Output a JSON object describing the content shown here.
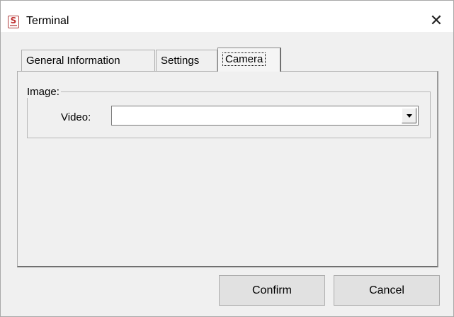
{
  "window": {
    "title": "Terminal",
    "app_icon_glyph": "S",
    "close_glyph": "✕"
  },
  "tabs": [
    {
      "label": "General Information",
      "active": false
    },
    {
      "label": "Settings",
      "active": false
    },
    {
      "label": "Camera",
      "active": true
    }
  ],
  "camera": {
    "group_label": "Image:",
    "video_label": "Video:",
    "video_value": "",
    "dropdown_icon": "chevron-down-icon"
  },
  "buttons": {
    "confirm_label": "Confirm",
    "cancel_label": "Cancel"
  },
  "colors": {
    "window_bg": "#f0f0f0",
    "titlebar_bg": "#ffffff",
    "button_bg": "#e1e1e1",
    "icon_accent": "#c03030"
  }
}
